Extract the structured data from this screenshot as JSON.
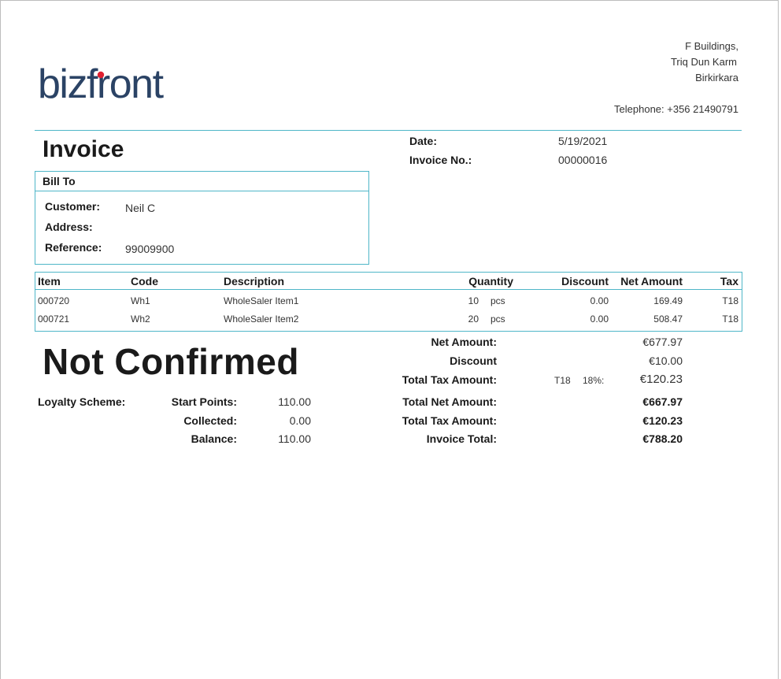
{
  "logo": {
    "text": "bizfront",
    "text_color": "#2b4365",
    "dot_color": "#e02030"
  },
  "company": {
    "address_lines": [
      "F Buildings,",
      "Triq Dun Karm",
      "Birkirkara"
    ],
    "telephone": "Telephone: +356 21490791"
  },
  "document": {
    "title": "Invoice",
    "status": "Not Confirmed"
  },
  "meta": {
    "date_label": "Date:",
    "date_value": "5/19/2021",
    "number_label": "Invoice No.:",
    "number_value": "00000016"
  },
  "bill_to": {
    "heading": "Bill To",
    "customer_label": "Customer:",
    "customer_value": "Neil C",
    "address_label": "Address:",
    "address_value": "",
    "reference_label": "Reference:",
    "reference_value": "99009900"
  },
  "items": {
    "headers": {
      "item": "Item",
      "code": "Code",
      "description": "Description",
      "quantity": "Quantity",
      "discount": "Discount",
      "net_amount": "Net Amount",
      "tax": "Tax"
    },
    "rows": [
      {
        "item": "000720",
        "code": "Wh1",
        "description": "WholeSaler Item1",
        "quantity": "10",
        "unit": "pcs",
        "discount": "0.00",
        "net_amount": "169.49",
        "tax": "T18"
      },
      {
        "item": "000721",
        "code": "Wh2",
        "description": "WholeSaler Item2",
        "quantity": "20",
        "unit": "pcs",
        "discount": "0.00",
        "net_amount": "508.47",
        "tax": "T18"
      }
    ]
  },
  "totals": {
    "net_amount_label": "Net Amount:",
    "net_amount_value": "€677.97",
    "discount_label": "Discount",
    "discount_value": "€10.00",
    "tax_label": "Total Tax Amount:",
    "tax_code": "T18",
    "tax_rate": "18%:",
    "tax_value": "€120.23",
    "total_net_label": "Total Net Amount:",
    "total_net_value": "€667.97",
    "total_tax_label": "Total Tax Amount:",
    "total_tax_value": "€120.23",
    "invoice_total_label": "Invoice Total:",
    "invoice_total_value": "€788.20"
  },
  "loyalty": {
    "scheme_label": "Loyalty Scheme:",
    "start_label": "Start Points:",
    "start_value": "110.00",
    "collected_label": "Collected:",
    "collected_value": "0.00",
    "balance_label": "Balance:",
    "balance_value": "110.00"
  },
  "colors": {
    "accent_border": "#4fb6c8"
  }
}
